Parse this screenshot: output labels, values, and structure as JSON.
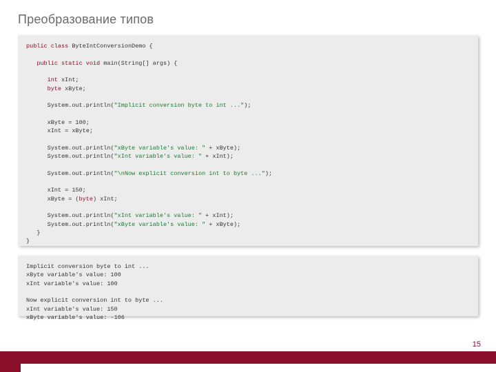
{
  "title": "Преобразование типов",
  "page_number": "15",
  "code": {
    "class_kw": "public class",
    "class_name": "ByteIntConversionDemo",
    "main_kw": "public static void",
    "main_sig": "main(String[] args)",
    "decl_int_kw": "int",
    "decl_int_id": "xInt;",
    "decl_byte_kw": "byte",
    "decl_byte_id": "xByte;",
    "sout": "System.out.println",
    "s1": "\"Implicit conversion byte to int ...\"",
    "assign1": "xByte = 100;",
    "assign2": "xInt = xByte;",
    "s2a": "\"xByte variable's value: \"",
    "s2b": " + xByte);",
    "s3a": "\"xInt variable's value: \"",
    "s3b": " + xInt);",
    "s4": "\"\\nNow explicit conversion int to byte ...\"",
    "assign3": "xInt = 150;",
    "assign4a": "xByte = (",
    "cast_kw": "byte",
    "assign4b": ") xInt;",
    "s5a": "\"xInt variable's value: \"",
    "s5b": " + xInt);",
    "s6a": "\"xByte variable's value: \"",
    "s6b": " + xByte);"
  },
  "output": "Implicit conversion byte to int ...\nxByte variable's value: 100\nxInt variable's value: 100\n\nNow explicit conversion int to byte ...\nxInt variable's value: 150\nxByte variable's value: -106"
}
